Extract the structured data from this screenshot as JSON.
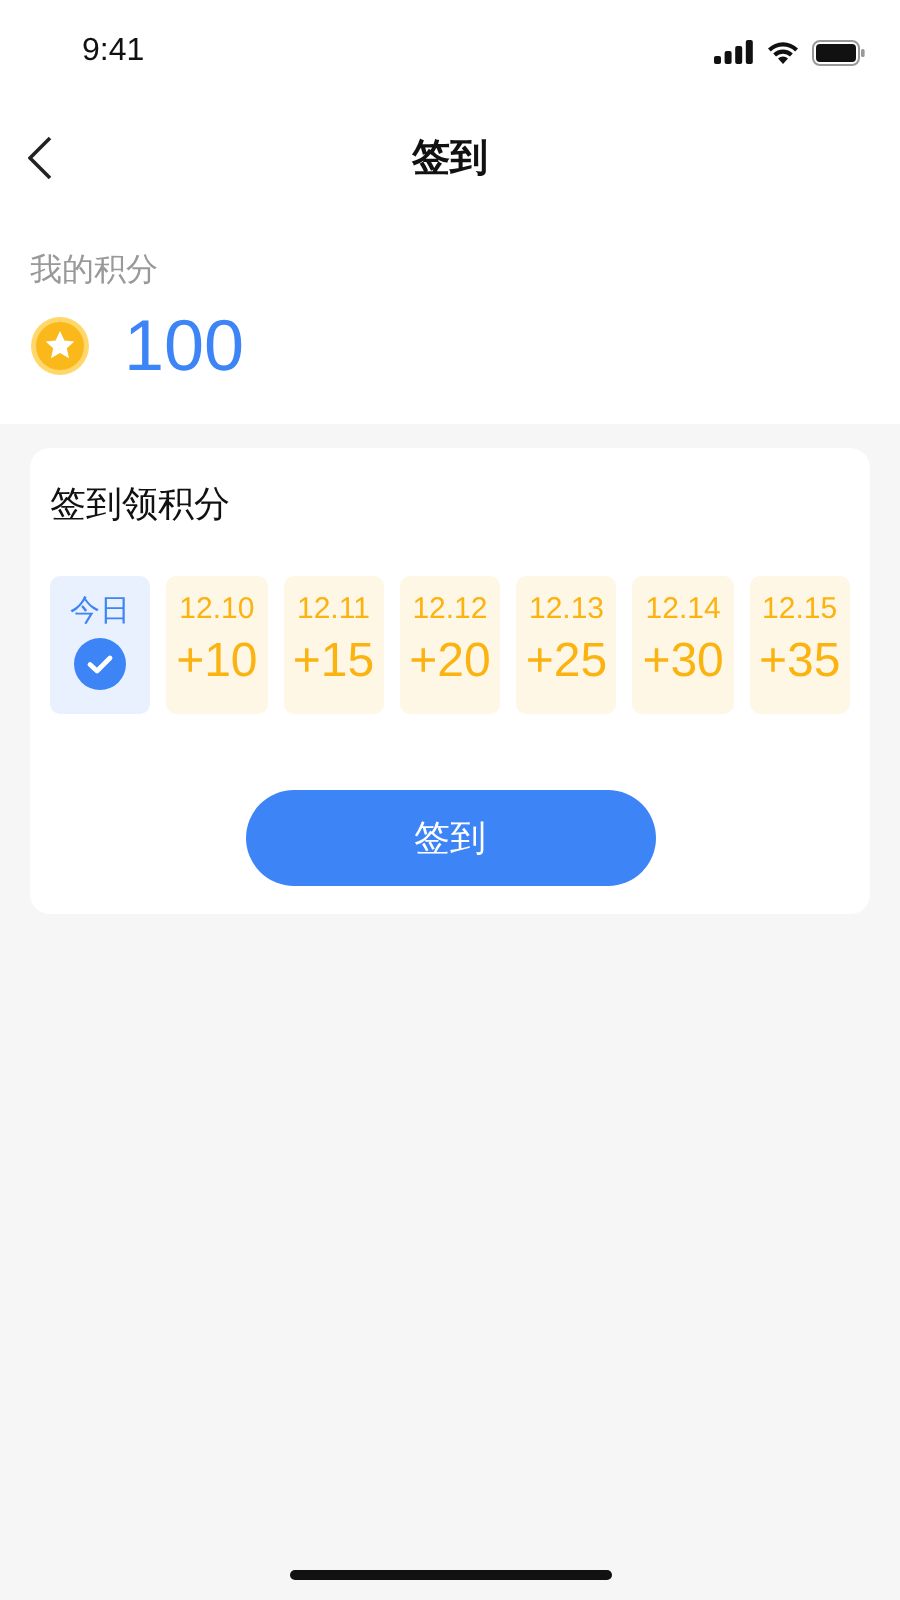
{
  "status_bar": {
    "time": "9:41"
  },
  "nav": {
    "title": "签到"
  },
  "points": {
    "label": "我的积分",
    "value": "100"
  },
  "checkin": {
    "title": "签到领积分",
    "days": [
      {
        "label": "今日",
        "checked": true
      },
      {
        "label": "12.10",
        "points": "+10",
        "checked": false
      },
      {
        "label": "12.11",
        "points": "+15",
        "checked": false
      },
      {
        "label": "12.12",
        "points": "+20",
        "checked": false
      },
      {
        "label": "12.13",
        "points": "+25",
        "checked": false
      },
      {
        "label": "12.14",
        "points": "+30",
        "checked": false
      },
      {
        "label": "12.15",
        "points": "+35",
        "checked": false
      }
    ],
    "button": "签到"
  }
}
